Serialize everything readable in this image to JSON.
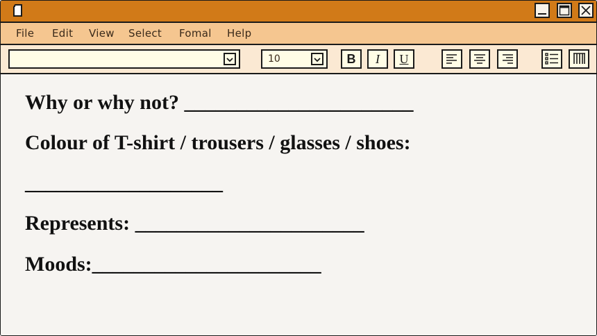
{
  "window": {
    "title_icon": "document-icon",
    "buttons": [
      "minimize-icon",
      "maximize-icon",
      "close-icon"
    ],
    "colors": {
      "titlebar": "#d17a18",
      "menubar": "#f5c690",
      "toolbar": "#fbe9d3",
      "content": "#f6f4f1"
    }
  },
  "menu": {
    "file": "File",
    "edit": "Edit",
    "view": "View",
    "select": "Select",
    "format": "Fomal",
    "help": "Help"
  },
  "toolbar": {
    "font_value": "",
    "size_value": "10",
    "bold_label": "B",
    "italic_label": "I",
    "underline_label": "U",
    "icons": [
      "align-left-icon",
      "align-center-icon",
      "align-right-icon",
      "bullet-list-icon",
      "columns-icon"
    ]
  },
  "document": {
    "line1": "Why or why not? ______________________",
    "line2": "Colour of T-shirt / trousers / glasses / shoes:",
    "line3": "___________________",
    "line4": "Represents: ______________________",
    "line5": "Moods:______________________"
  }
}
